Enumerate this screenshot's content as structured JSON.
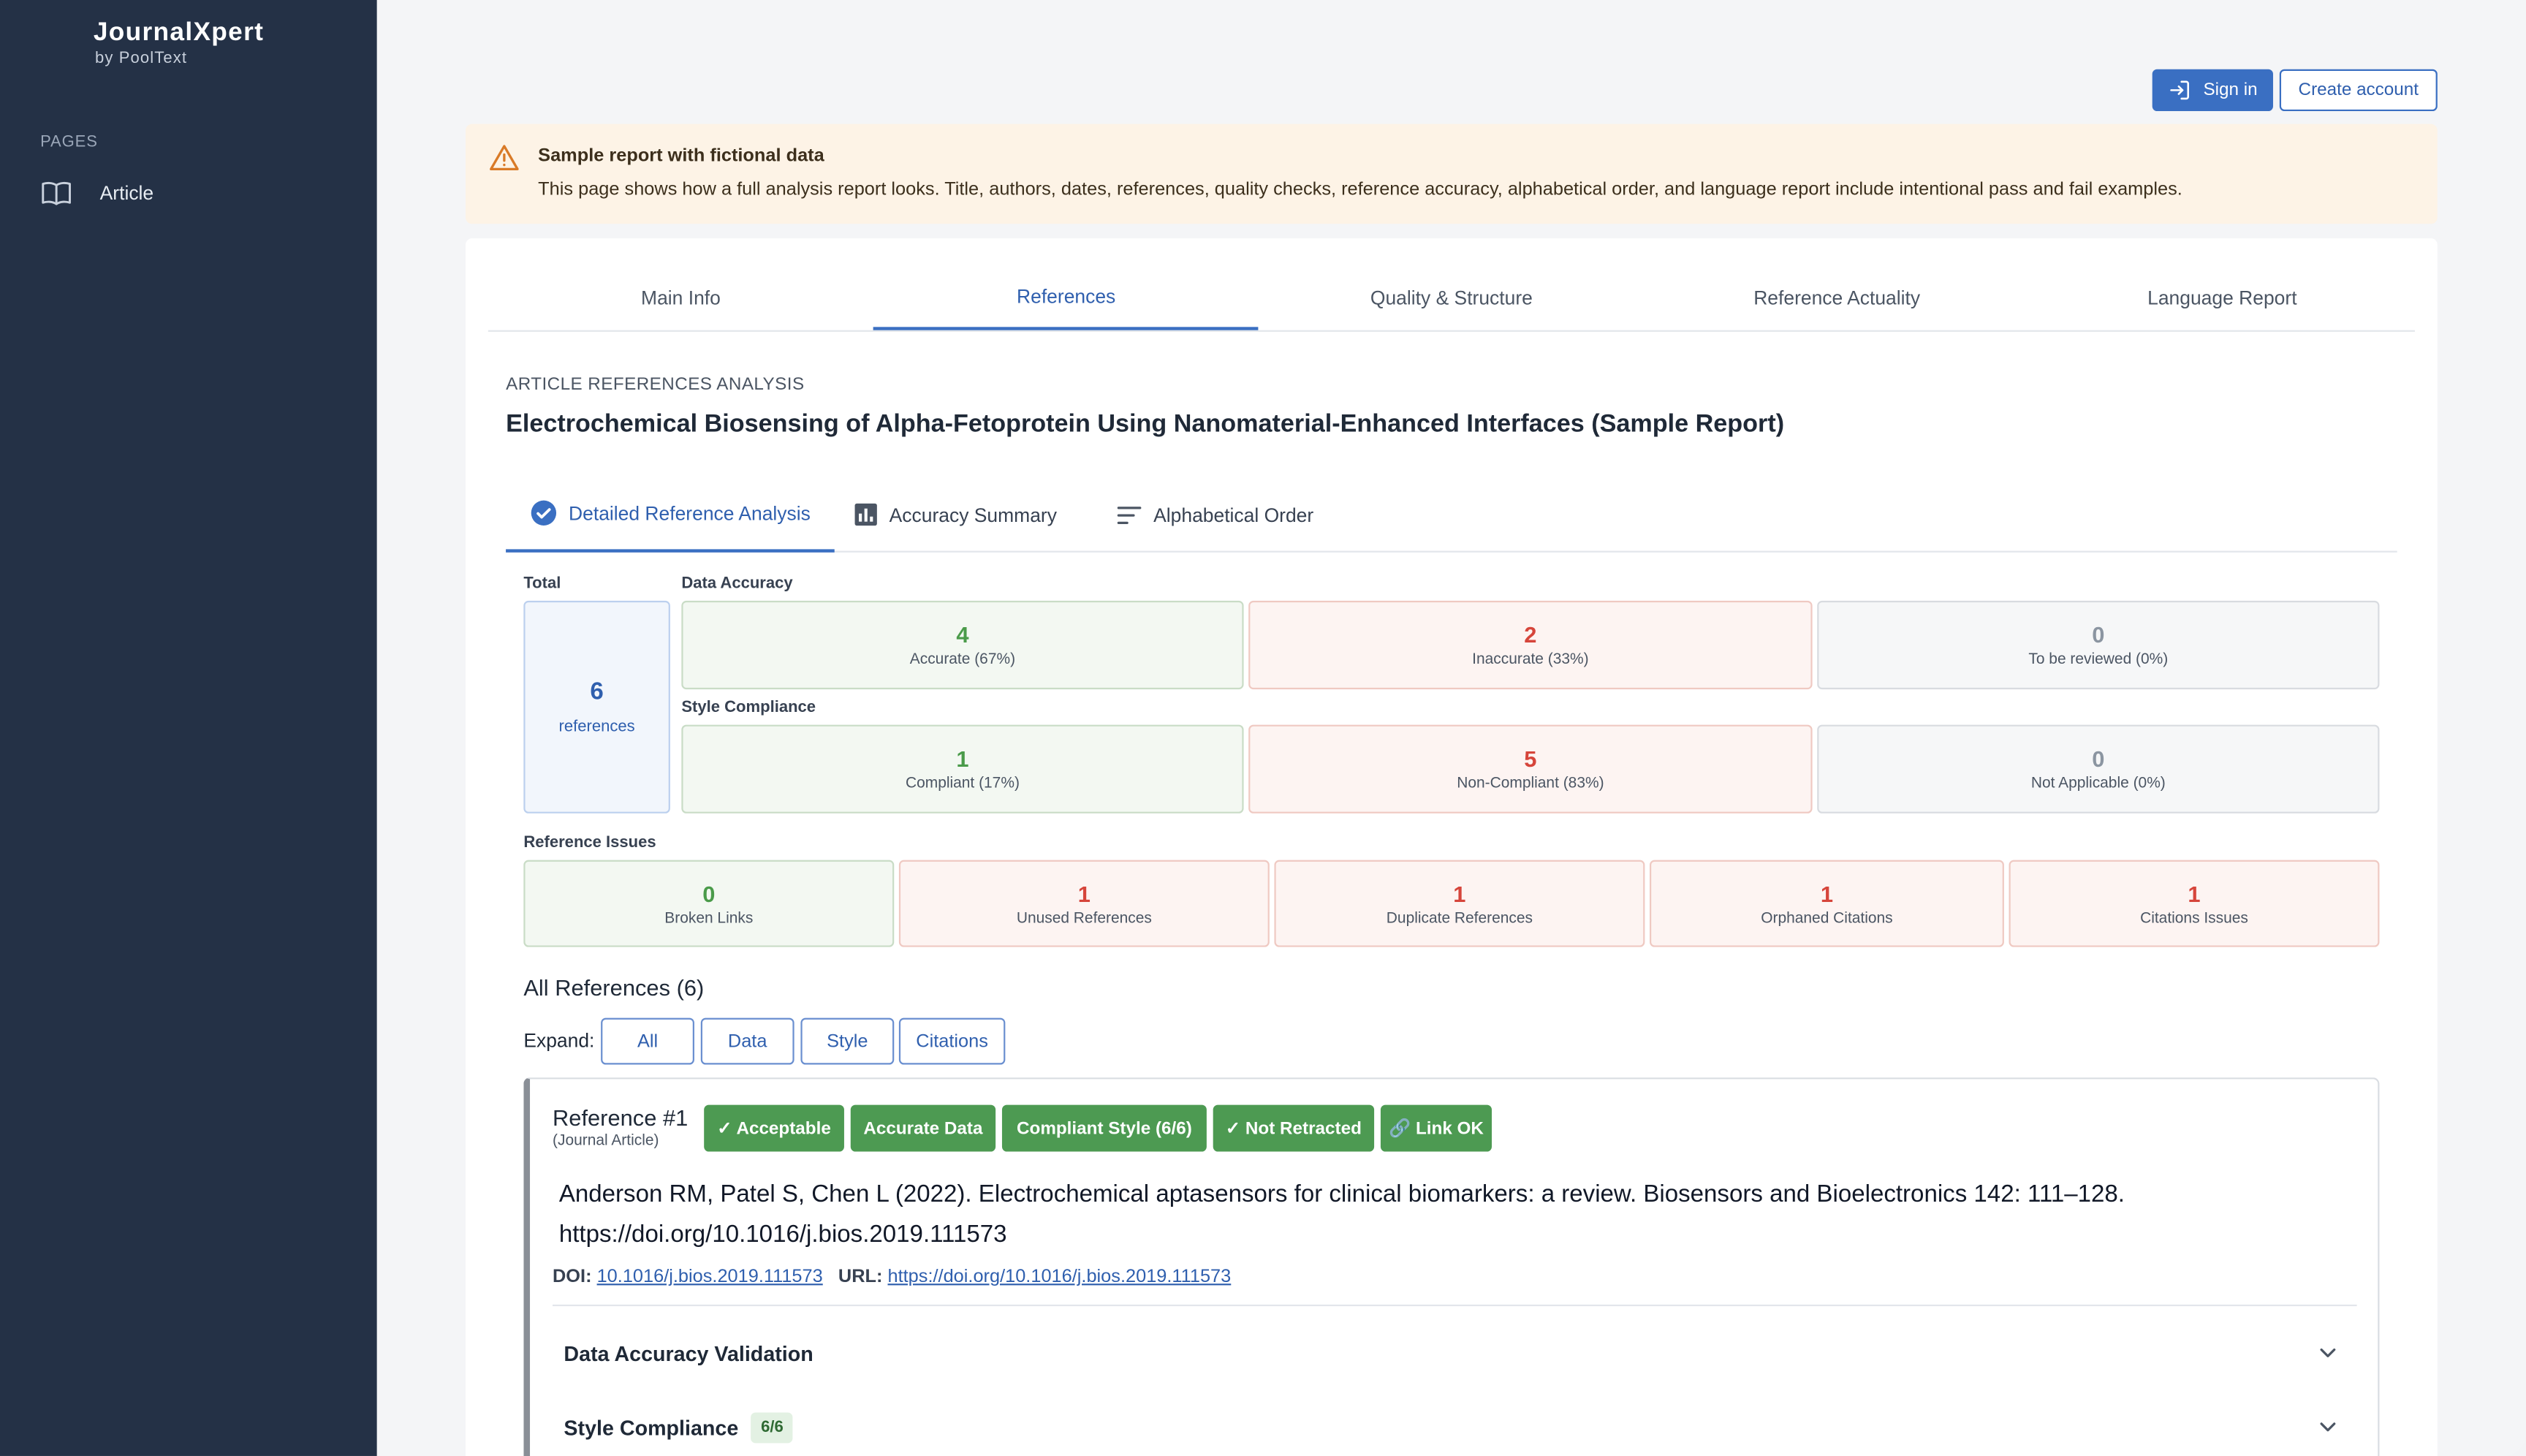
{
  "app": {
    "brand": "JournalXpert",
    "brand_sub": "by PoolText"
  },
  "sidebar": {
    "section_label": "PAGES",
    "items": [
      {
        "label": "Article",
        "icon": "book-open-icon"
      }
    ]
  },
  "header": {
    "signin_label": "Sign in",
    "create_account_label": "Create account"
  },
  "alert": {
    "title": "Sample report with fictional data",
    "body": "This page shows how a full analysis report looks. Title, authors, dates, references, quality checks, reference accuracy, alphabetical order, and language report include intentional pass and fail examples.",
    "icon": "warning-triangle-icon"
  },
  "tabs": [
    {
      "label": "Main Info"
    },
    {
      "label": "References",
      "active": true
    },
    {
      "label": "Quality & Structure"
    },
    {
      "label": "Reference Actuality"
    },
    {
      "label": "Language Report"
    }
  ],
  "analysis": {
    "section_label": "ARTICLE REFERENCES ANALYSIS",
    "title": "Electrochemical Biosensing of Alpha-Fetoprotein Using Nanomaterial-Enhanced Interfaces (Sample Report)"
  },
  "subtabs": [
    {
      "label": "Detailed Reference Analysis",
      "icon": "check-circle-icon",
      "active": true
    },
    {
      "label": "Accuracy Summary",
      "icon": "bar-chart-icon"
    },
    {
      "label": "Alphabetical Order",
      "icon": "sort-lines-icon"
    }
  ],
  "stats": {
    "total_label": "Total",
    "total_value": "6",
    "total_unit": "references",
    "data_accuracy_label": "Data Accuracy",
    "data_accuracy": [
      {
        "value": "4",
        "label": "Accurate (67%)"
      },
      {
        "value": "2",
        "label": "Inaccurate (33%)"
      },
      {
        "value": "0",
        "label": "To be reviewed (0%)"
      }
    ],
    "style_compliance_label": "Style Compliance",
    "style_compliance": [
      {
        "value": "1",
        "label": "Compliant (17%)"
      },
      {
        "value": "5",
        "label": "Non-Compliant (83%)"
      },
      {
        "value": "0",
        "label": "Not Applicable (0%)"
      }
    ],
    "issues_label": "Reference Issues",
    "issues": [
      {
        "value": "0",
        "label": "Broken Links"
      },
      {
        "value": "1",
        "label": "Unused References"
      },
      {
        "value": "1",
        "label": "Duplicate References"
      },
      {
        "value": "1",
        "label": "Orphaned Citations"
      },
      {
        "value": "1",
        "label": "Citations Issues"
      }
    ]
  },
  "references": {
    "heading": "All References (6)",
    "expand_label": "Expand:",
    "expand_buttons": [
      "All",
      "Data",
      "Style",
      "Citations"
    ],
    "items": [
      {
        "title": "Reference #1",
        "type": "(Journal Article)",
        "badges": [
          "✓ Acceptable",
          "Accurate Data",
          "Compliant Style (6/6)",
          "✓ Not Retracted",
          "🔗 Link OK"
        ],
        "citation": "Anderson RM, Patel S, Chen L (2022). Electrochemical aptasensors for clinical biomarkers: a review. Biosensors and Bioelectronics 142: 111–128. https://doi.org/10.1016/j.bios.2019.111573",
        "doi_label": "DOI:",
        "doi": "10.1016/j.bios.2019.111573",
        "url_label": "URL:",
        "url": "https://doi.org/10.1016/j.bios.2019.111573",
        "sections": [
          {
            "title": "Data Accuracy Validation"
          },
          {
            "title": "Style Compliance",
            "badge": "6/6"
          }
        ]
      }
    ]
  },
  "colors": {
    "sidebar": "#243146",
    "accent": "#3a6fc2",
    "success": "#4d9a52",
    "danger": "#d6453b",
    "alert_bg": "#fdf3e6"
  }
}
